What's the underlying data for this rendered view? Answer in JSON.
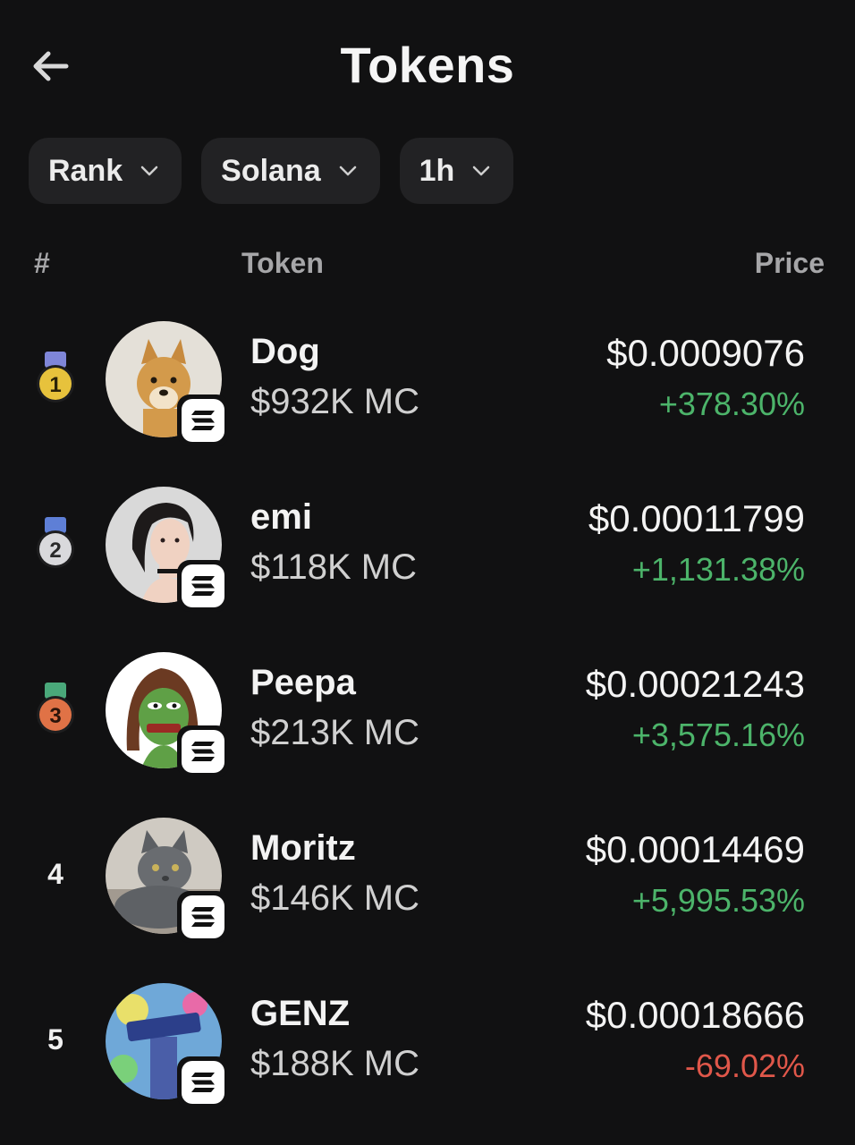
{
  "header": {
    "title": "Tokens",
    "back_icon": "arrow-left-icon"
  },
  "filters": [
    {
      "label": "Rank"
    },
    {
      "label": "Solana"
    },
    {
      "label": "1h"
    }
  ],
  "columns": {
    "rank": "#",
    "token": "Token",
    "price": "Price"
  },
  "tokens": [
    {
      "rank": "1",
      "medal": "gold",
      "name": "Dog",
      "mc": "$932K MC",
      "price": "$0.0009076",
      "change": "+378.30%",
      "trend": "up"
    },
    {
      "rank": "2",
      "medal": "silver",
      "name": "emi",
      "mc": "$118K MC",
      "price": "$0.00011799",
      "change": "+1,131.38%",
      "trend": "up"
    },
    {
      "rank": "3",
      "medal": "bronze",
      "name": "Peepa",
      "mc": "$213K MC",
      "price": "$0.00021243",
      "change": "+3,575.16%",
      "trend": "up"
    },
    {
      "rank": "4",
      "medal": "none",
      "name": "Moritz",
      "mc": "$146K MC",
      "price": "$0.00014469",
      "change": "+5,995.53%",
      "trend": "up"
    },
    {
      "rank": "5",
      "medal": "none",
      "name": "GENZ",
      "mc": "$188K MC",
      "price": "$0.00018666",
      "change": "-69.02%",
      "trend": "down"
    }
  ],
  "colors": {
    "background": "#111112",
    "pill": "#222224",
    "positive": "#4cb46a",
    "negative": "#e0574a",
    "muted": "#a6a6a8"
  },
  "icons": {
    "chain_badge": "solana-icon",
    "chevron": "chevron-down-icon"
  }
}
